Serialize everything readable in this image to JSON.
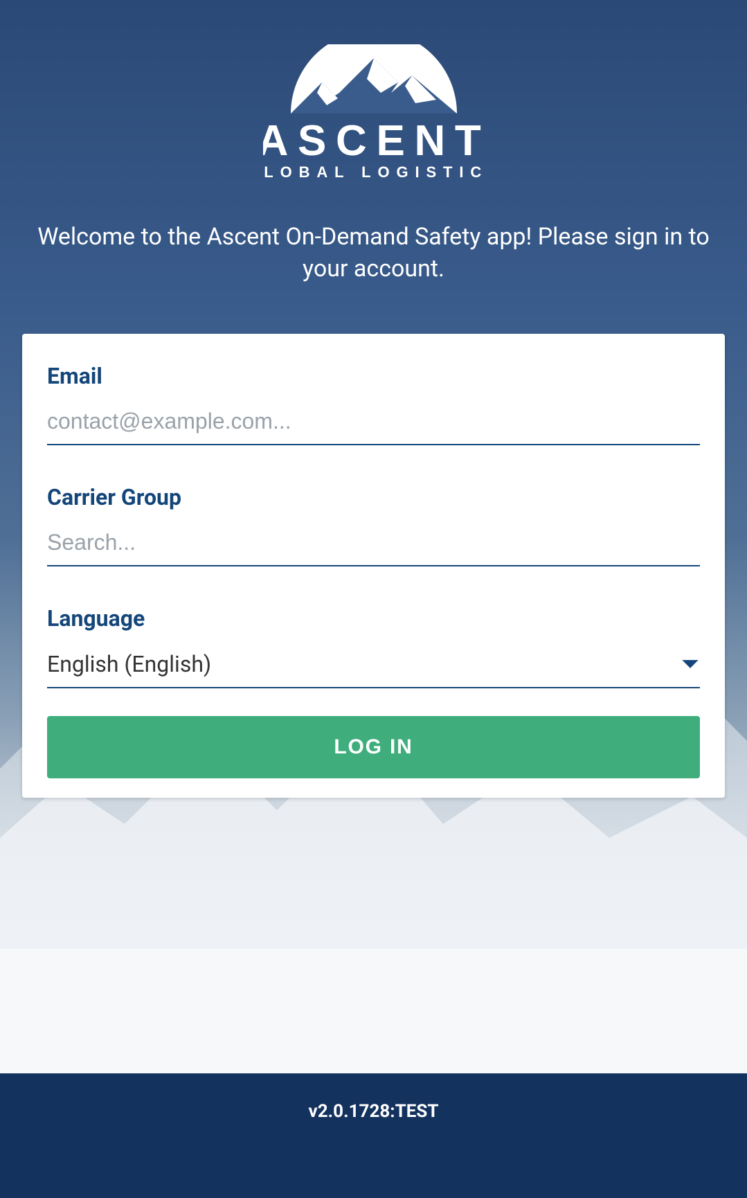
{
  "brand": {
    "name_main": "ASCENT",
    "name_sub": "GLOBAL LOGISTICS"
  },
  "welcome_text": "Welcome to the Ascent On-Demand Safety app! Please sign in to your account.",
  "form": {
    "email": {
      "label": "Email",
      "placeholder": "contact@example.com...",
      "value": ""
    },
    "carrier_group": {
      "label": "Carrier Group",
      "placeholder": "Search...",
      "value": ""
    },
    "language": {
      "label": "Language",
      "selected": "English (English)"
    },
    "login_button": "LOG IN"
  },
  "footer": {
    "version": "v2.0.1728:TEST"
  },
  "colors": {
    "brand_blue": "#14467a",
    "footer_blue": "#14325e",
    "login_green": "#3fae7c"
  }
}
